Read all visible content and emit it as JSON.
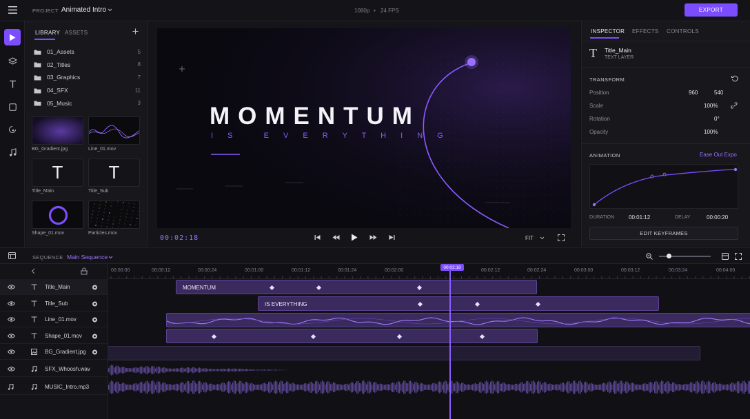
{
  "header": {
    "project_label": "PROJECT",
    "project_name": "Animated Intro",
    "format": "1080p",
    "separator": "•",
    "fps": "24 FPS",
    "export_label": "EXPORT"
  },
  "library": {
    "tabs": [
      "LIBRARY",
      "ASSETS"
    ],
    "folders": [
      {
        "name": "01_Assets",
        "count": "5"
      },
      {
        "name": "02_Titles",
        "count": "8"
      },
      {
        "name": "03_Graphics",
        "count": "7"
      },
      {
        "name": "04_SFX",
        "count": "11"
      },
      {
        "name": "05_Music",
        "count": "3"
      }
    ],
    "assets": [
      {
        "name": "BG_Gradient.jpg",
        "kind": "gradient"
      },
      {
        "name": "Line_01.mov",
        "kind": "waveline"
      },
      {
        "name": "Title_Main",
        "kind": "text"
      },
      {
        "name": "Title_Sub",
        "kind": "text"
      },
      {
        "name": "Shape_01.mov",
        "kind": "ring"
      },
      {
        "name": "Particles.mov",
        "kind": "particles"
      }
    ],
    "text_glyph": "T"
  },
  "preview": {
    "title": "MOMENTUM",
    "subtitle": "I S   E V E R Y T H I N G",
    "timecode": "00:02:18",
    "fit_label": "FIT"
  },
  "inspector": {
    "tabs": [
      "INSPECTOR",
      "EFFECTS",
      "CONTROLS"
    ],
    "layer_glyph": "T",
    "layer_name": "Title_Main",
    "layer_type": "TEXT LAYER",
    "transform_title": "TRANSFORM",
    "position_label": "Position",
    "position_x": "960",
    "position_y": "540",
    "scale_label": "Scale",
    "scale_value": "100%",
    "rotation_label": "Rotation",
    "rotation_value": "0°",
    "opacity_label": "Opacity",
    "opacity_value": "100%",
    "animation_title": "ANIMATION",
    "easing": "Ease Out Expo",
    "duration_label": "DURATION",
    "duration_value": "00:01:12",
    "delay_label": "DELAY",
    "delay_value": "00:00:20",
    "edit_keyframes": "EDIT KEYFRAMES"
  },
  "sequence": {
    "label": "SEQUENCE",
    "name": "Main Sequence",
    "playhead": "00:02:18",
    "ticks": [
      "00:00:00",
      "00:00:12",
      "00:00:24",
      "00:01:00",
      "00:01:12",
      "00:01:24",
      "00:02:00",
      "00:02:12",
      "00:02:24",
      "00:03:00",
      "00:03:12",
      "00:03:24",
      "00:04:00"
    ],
    "tracks": [
      {
        "name": "Title_Main",
        "type": "text"
      },
      {
        "name": "Title_Sub",
        "type": "text"
      },
      {
        "name": "Line_01.mov",
        "type": "text"
      },
      {
        "name": "Shape_01.mov",
        "type": "text"
      },
      {
        "name": "BG_Gradient.jpg",
        "type": "image"
      },
      {
        "name": "SFX_Whoosh.wav",
        "type": "audio"
      },
      {
        "name": "MUSIC_Intro.mp3",
        "type": "audio"
      }
    ],
    "clip_title_main": "MOMENTUM",
    "clip_title_sub": "IS EVERYTHING"
  },
  "colors": {
    "accent": "#7c4dff",
    "bg": "#121216"
  }
}
